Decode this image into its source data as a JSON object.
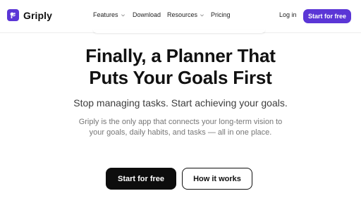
{
  "brand": {
    "name": "Griply",
    "logo_icon": "griply-logo-icon",
    "accent_color": "#5b36d6"
  },
  "nav": {
    "items": [
      {
        "label": "Features",
        "has_dropdown": true
      },
      {
        "label": "Download",
        "has_dropdown": false
      },
      {
        "label": "Resources",
        "has_dropdown": true
      },
      {
        "label": "Pricing",
        "has_dropdown": false
      }
    ],
    "login_label": "Log in",
    "cta_label": "Start for free"
  },
  "hero": {
    "title_line1": "Finally, a Planner That",
    "title_line2": "Puts Your Goals First",
    "subtitle": "Stop managing tasks. Start achieving your goals.",
    "description": "Griply is the only app that connects your long-term vision to your goals, daily habits, and tasks — all in one place.",
    "primary_button": "Start for free",
    "secondary_button": "How it works"
  }
}
